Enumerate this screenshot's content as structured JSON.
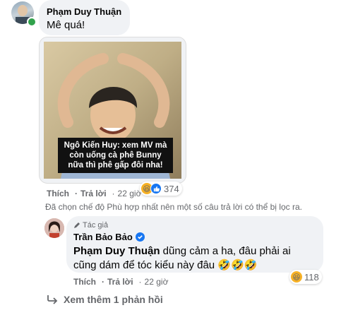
{
  "comment1": {
    "author": "Phạm Duy Thuận",
    "text": "Mê quá!",
    "meme_caption": "Ngô Kiến Huy: xem MV mà còn uống cà phê Bunny nữa thì phê gấp đôi nha!",
    "actions": {
      "like": "Thích",
      "reply": "Trả lời",
      "time": "22 giờ"
    },
    "reactions_count": "374"
  },
  "filter_notice": "Đã chọn chế độ Phù hợp nhất nên một số câu trả lời có thể bị lọc ra.",
  "reply1": {
    "badge": "Tác giả",
    "author": "Trần Bảo Bảo",
    "mention": "Phạm Duy Thuận",
    "text_line1": " dũng cảm a ha, đâu phải ai",
    "text_line2": "cũng dám để tóc kiểu này đâu 🤣🤣🤣",
    "reactions_count": "118",
    "actions": {
      "like": "Thích",
      "reply": "Trả lời",
      "time": "22 giờ"
    }
  },
  "more_replies": "Xem thêm 1 phản hồi",
  "colors": {
    "bubble": "#f0f2f5",
    "secondary": "#65676b",
    "online": "#31a24c",
    "verified": "#1877f2",
    "like_blue": "#1877f2"
  }
}
